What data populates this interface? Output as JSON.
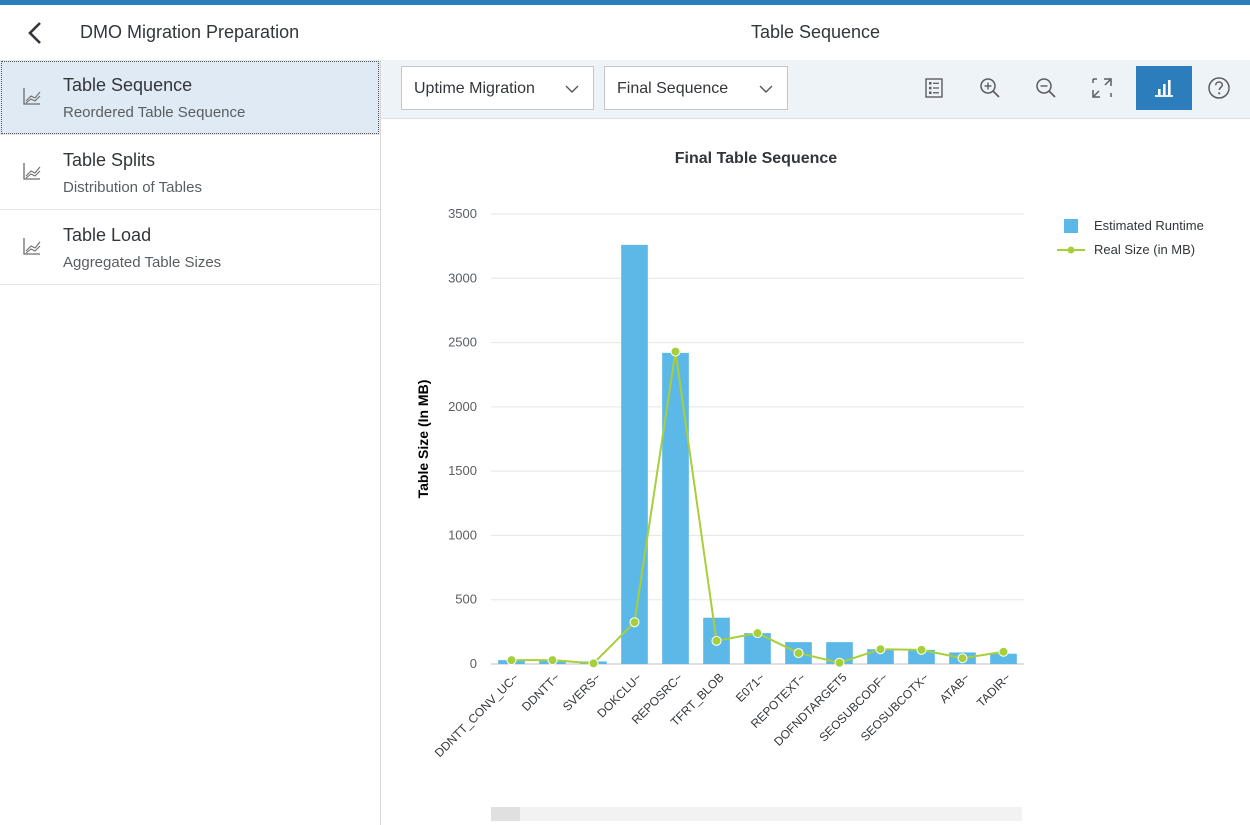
{
  "header": {
    "back_icon": "chevron-left-icon",
    "left_title": "DMO Migration Preparation",
    "right_title": "Table Sequence"
  },
  "nav": {
    "items": [
      {
        "label": "Table Sequence",
        "sub": "Reordered Table Sequence",
        "icon": "line-chart-icon",
        "selected": true
      },
      {
        "label": "Table Splits",
        "sub": "Distribution of Tables",
        "icon": "line-chart-icon",
        "selected": false
      },
      {
        "label": "Table Load",
        "sub": "Aggregated Table Sizes",
        "icon": "line-chart-icon",
        "selected": false
      }
    ]
  },
  "toolbar": {
    "migration_select": "Uptime Migration",
    "sequence_select": "Final Sequence",
    "buttons": [
      "legend-icon",
      "zoom-in-icon",
      "zoom-out-icon",
      "fullscreen-icon",
      "chart-icon",
      "help-icon"
    ]
  },
  "colors": {
    "accent": "#2b7dbc",
    "bar": "#5cb8e6",
    "line": "#a7cf3a"
  },
  "chart_data": {
    "type": "bar",
    "title": "Final Table Sequence",
    "ylabel": "Table Size (In MB)",
    "xlabel": "",
    "ylim": [
      0,
      3500
    ],
    "yticks": [
      0,
      500,
      1000,
      1500,
      2000,
      2500,
      3000,
      3500
    ],
    "grid": true,
    "legend_position": "top-right",
    "categories": [
      "DDNTT_CONV_UC~",
      "DDNTT~",
      "SVERS~",
      "DOKCLU~",
      "REPOSRC~",
      "TFRT_BLOB",
      "E071~",
      "REPOTEXT~",
      "DOFNDTARGET5",
      "SEOSUBCODF~",
      "SEOSUBCOTX~",
      "ATAB~",
      "TADIR~"
    ],
    "series": [
      {
        "name": "Estimated Runtime",
        "type": "bar",
        "values": [
          30,
          30,
          20,
          3260,
          2420,
          360,
          240,
          170,
          170,
          115,
          110,
          90,
          80
        ]
      },
      {
        "name": "Real Size (in MB)",
        "type": "line",
        "values": [
          30,
          30,
          5,
          325,
          2430,
          180,
          240,
          85,
          10,
          115,
          110,
          45,
          95
        ]
      }
    ]
  }
}
